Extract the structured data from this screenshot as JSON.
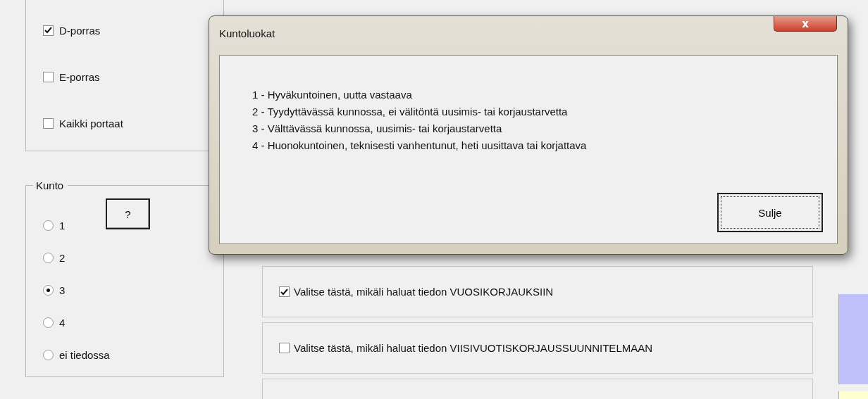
{
  "stair_group": {
    "items": [
      {
        "label": "D-porras",
        "checked": true
      },
      {
        "label": "E-porras",
        "checked": false
      },
      {
        "label": "Kaikki portaat",
        "checked": false
      }
    ]
  },
  "condition_group": {
    "title": "Kunto",
    "help_button": "?",
    "options": [
      {
        "label": "1",
        "selected": false
      },
      {
        "label": "2",
        "selected": false
      },
      {
        "label": "3",
        "selected": true
      },
      {
        "label": "4",
        "selected": false
      },
      {
        "label": "ei tiedossa",
        "selected": false
      }
    ]
  },
  "option_panels": [
    {
      "label": "Valitse tästä, mikäli haluat tiedon VUOSIKORJAUKSIIN",
      "checked": true
    },
    {
      "label": "Valitse tästä, mikäli haluat tiedon VIISIVUOTISKORJAUSSUUNNITELMAAN",
      "checked": false
    }
  ],
  "dialog": {
    "title": "Kuntoluokat",
    "close_button": "x",
    "lines": [
      "1 - Hyväkuntoinen, uutta vastaava",
      "2 - Tyydyttävässä kunnossa, ei välitöntä uusimis- tai korjaustarvetta",
      "3 - Välttävässä kunnossa, uusimis- tai korjaustarvetta",
      "4 - Huonokuntoinen, teknisesti vanhentunut, heti uusittava tai korjattava"
    ],
    "button": "Sulje"
  }
}
